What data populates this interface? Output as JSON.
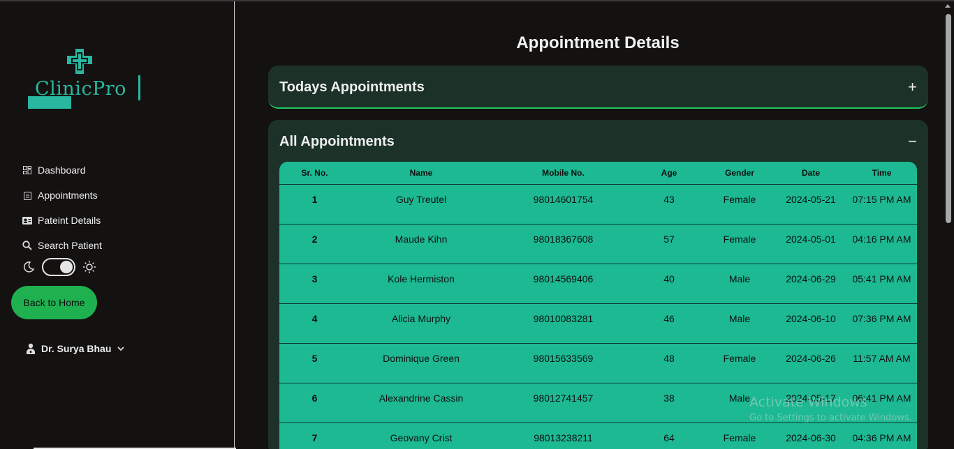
{
  "brand": {
    "name": "ClinicPro"
  },
  "sidebar": {
    "items": [
      {
        "label": "Dashboard",
        "icon": "dashboard-icon"
      },
      {
        "label": "Appointments",
        "icon": "calendar-icon"
      },
      {
        "label": "Pateint Details",
        "icon": "id-card-icon"
      },
      {
        "label": "Search Patient",
        "icon": "search-icon"
      }
    ],
    "theme_toggle": {
      "state": "dark"
    },
    "home_button": "Back to Home",
    "user": "Dr. Surya Bhau"
  },
  "main": {
    "title": "Appointment Details",
    "today": {
      "label": "Todays Appointments",
      "sign": "+"
    },
    "all": {
      "label": "All Appointments",
      "sign": "−"
    },
    "columns": [
      "Sr. No.",
      "Name",
      "Mobile No.",
      "Age",
      "Gender",
      "Date",
      "Time"
    ],
    "rows": [
      {
        "sr": "1",
        "name": "Guy Treutel",
        "mobile": "98014601754",
        "age": "43",
        "gender": "Female",
        "date": "2024-05-21",
        "time": "07:15 PM AM"
      },
      {
        "sr": "2",
        "name": "Maude Kihn",
        "mobile": "98018367608",
        "age": "57",
        "gender": "Female",
        "date": "2024-05-01",
        "time": "04:16 PM AM"
      },
      {
        "sr": "3",
        "name": "Kole Hermiston",
        "mobile": "98014569406",
        "age": "40",
        "gender": "Male",
        "date": "2024-06-29",
        "time": "05:41 PM AM"
      },
      {
        "sr": "4",
        "name": "Alicia Murphy",
        "mobile": "98010083281",
        "age": "46",
        "gender": "Male",
        "date": "2024-06-10",
        "time": "07:36 PM AM"
      },
      {
        "sr": "5",
        "name": "Dominique Green",
        "mobile": "98015633569",
        "age": "48",
        "gender": "Female",
        "date": "2024-06-26",
        "time": "11:57 AM AM"
      },
      {
        "sr": "6",
        "name": "Alexandrine Cassin",
        "mobile": "98012741457",
        "age": "38",
        "gender": "Male",
        "date": "2024-05-17",
        "time": "06:41 PM AM"
      },
      {
        "sr": "7",
        "name": "Geovany Crist",
        "mobile": "98013238211",
        "age": "64",
        "gender": "Female",
        "date": "2024-06-30",
        "time": "04:36 PM AM"
      }
    ]
  },
  "watermark": {
    "line1": "Activate Windows",
    "line2": "Go to Settings to activate Windows."
  },
  "colors": {
    "accent": "#1cb993",
    "brand": "#2ab7a0",
    "button": "#1fb14f",
    "panel": "#1c3229",
    "background": "#141111"
  }
}
